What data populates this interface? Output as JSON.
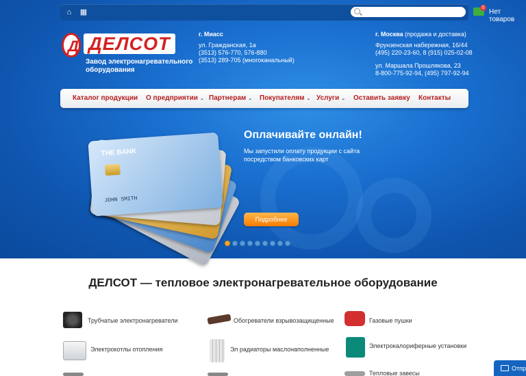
{
  "topbar": {
    "home_icon": "home-icon",
    "sitemap_icon": "sitemap-icon",
    "search_placeholder": "",
    "cart_count": "0",
    "cart_text": "Нет товаров"
  },
  "logo": {
    "letter": "Д",
    "word": "ДЕЛСОТ",
    "tagline": "Завод электронагревательного оборудования"
  },
  "miass": {
    "city": "г. Миасс",
    "street": "ул. Гражданская, 1а",
    "phone1": "(3513) 576-770, 576-880",
    "phone2": "(3513) 289-705 (многоканальный)"
  },
  "moscow": {
    "city": "г. Москва",
    "note": "(продажа и доставка)",
    "addr1": "Фрунзенская набережная, 16/44",
    "phone1": "(495) 220-23-60, 8 (915) 025-02-08",
    "addr2": "ул. Маршала Прошлякова, 23",
    "phone2": "8-800-775-92-94, (495) 797-92-94"
  },
  "nav": [
    {
      "label": "Каталог продукции",
      "caret": false
    },
    {
      "label": "О предприятии",
      "caret": true
    },
    {
      "label": "Партнерам",
      "caret": true
    },
    {
      "label": "Покупателям",
      "caret": true
    },
    {
      "label": "Услуги",
      "caret": true
    },
    {
      "label": "Оставить заявку",
      "caret": false
    },
    {
      "label": "Контакты",
      "caret": false
    }
  ],
  "promo": {
    "title": "Оплачивайте онлайн!",
    "text": "Мы запустили оплату продукции с сайта посредством банковских карт",
    "button": "Подробнее",
    "slides_total": 9,
    "slide_active": 1,
    "card_bank": "THE BANK",
    "card_holder": "JOHN SMITH"
  },
  "heading": "ДЕЛСОТ — тепловое электронагревательное оборудование",
  "products": [
    {
      "label": "Трубчатые электронагреватели",
      "icon": "tubular-heater-icon"
    },
    {
      "label": "Обогреватели взрывозащищенные",
      "icon": "explosion-proof-heater-icon"
    },
    {
      "label": "Газовые пушки",
      "icon": "gas-cannon-icon"
    },
    {
      "label": "Электрокотлы отопления",
      "icon": "electric-boiler-icon"
    },
    {
      "label": "Эл радиаторы маслонаполненные",
      "icon": "oil-radiator-icon"
    },
    {
      "label": "Электрокалориферные установки",
      "icon": "air-heater-unit-icon"
    },
    {
      "label": "Тепловые завесы",
      "icon": "air-curtain-icon"
    }
  ],
  "chat": {
    "label": "Отпр"
  },
  "colors": {
    "brand_red": "#d32121",
    "hero_blue": "#1a6fcf",
    "accent_orange": "#f57c00"
  }
}
